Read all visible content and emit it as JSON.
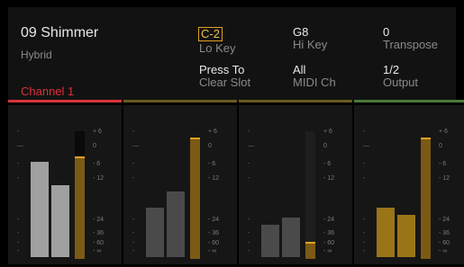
{
  "patch": {
    "name": "09 Shimmer",
    "type": "Hybrid",
    "channel": "Channel 1"
  },
  "params": [
    {
      "value": "C-2",
      "label": "Lo Key",
      "selected": true
    },
    {
      "value": "G8",
      "label": "Hi Key"
    },
    {
      "value": "0",
      "label": "Transpose"
    },
    {
      "value": "Press To",
      "label": "Clear Slot"
    },
    {
      "value": "All",
      "label": "MIDI Ch"
    },
    {
      "value": "1/2",
      "label": "Output"
    }
  ],
  "meter_scale": [
    "+ 6",
    "0",
    "- 6",
    "- 12",
    "- 24",
    "- 36",
    "- 60",
    "- ∞"
  ],
  "channels": [
    {
      "accent": "#d8343c",
      "fader_level": 0.8,
      "level_l": 0.29,
      "level_r": 0.22
    },
    {
      "accent": "#6a5a22",
      "fader_level": 0.95,
      "level_l": 0.15,
      "level_r": 0.2
    },
    {
      "accent": "#6a5a22",
      "fader_level": 0.12,
      "level_l": 0.1,
      "level_r": 0.12
    },
    {
      "accent": "#4a7a3a",
      "fader_level": 0.95,
      "level_l": 0.15,
      "level_r": 0.13
    }
  ],
  "colors": {
    "fader_active": "#9a6a1a",
    "level_active": "#a0a0a0",
    "level_dim": "#4a4a4a",
    "level_gold": "#9a7518"
  }
}
